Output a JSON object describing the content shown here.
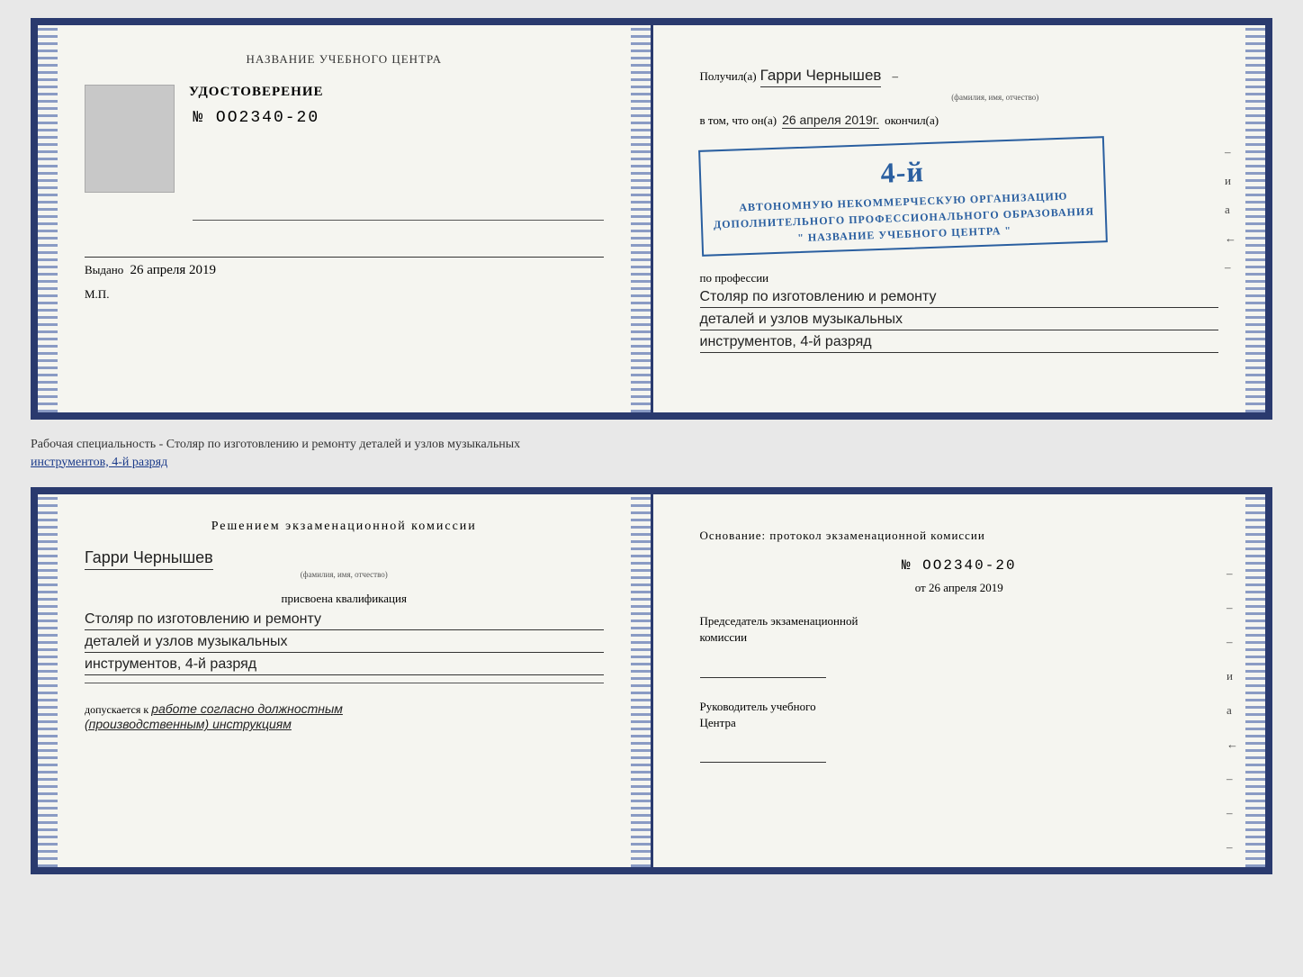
{
  "top": {
    "left": {
      "title": "НАЗВАНИЕ УЧЕБНОГО ЦЕНТРА",
      "udostoverenie": "УДОСТОВЕРЕНИЕ",
      "number": "№ OO2340-20",
      "vydano_label": "Выдано",
      "vydano_date": "26 апреля 2019",
      "mp": "М.П."
    },
    "right": {
      "poluchil": "Получил(а)",
      "name_handwritten": "Гарри Чернышев",
      "fio_subtitle": "(фамилия, имя, отчество)",
      "dash1": "–",
      "vtom": "в том, что он(а)",
      "date_handwritten": "26 апреля 2019г.",
      "okonchil": "окончил(а)",
      "stamp_line1": "АВТОНОМНУЮ НЕКОММЕРЧЕСКУЮ ОРГАНИЗАЦИЮ",
      "stamp_line2": "ДОПОЛНИТЕЛЬНОГО ПРОФЕССИОНАЛЬНОГО ОБРАЗОВАНИЯ",
      "stamp_line3": "\" НАЗВАНИЕ УЧЕБНОГО ЦЕНТРА \"",
      "stamp_4y": "4-й",
      "po_professii": "по профессии",
      "profession1": "Столяр по изготовлению и ремонту",
      "profession2": "деталей и узлов музыкальных",
      "profession3": "инструментов, 4-й разряд",
      "dash_i": "и",
      "dash_a": "а",
      "dash_left": "←",
      "dashes": [
        "–",
        "–",
        "–",
        "–",
        "–"
      ]
    }
  },
  "separator": {
    "text": "Рабочая специальность - Столяр по изготовлению и ремонту деталей и узлов музыкальных",
    "text2_underline": "инструментов, 4-й разряд"
  },
  "bottom": {
    "left": {
      "resheniem": "Решением  экзаменационной  комиссии",
      "name_handwritten": "Гарри Чернышев",
      "fio_subtitle": "(фамилия, имя, отчество)",
      "prisvoena": "присвоена квалификация",
      "profession1": "Столяр по изготовлению и ремонту",
      "profession2": "деталей и узлов музыкальных",
      "profession3": "инструментов, 4-й разряд",
      "dopuskaetsya": "допускается к",
      "dopusk_italic": "работе согласно должностным",
      "dopusk_italic2": "(производственным) инструкциям"
    },
    "right": {
      "osnovanie": "Основание: протокол  экзаменационной  комиссии",
      "number": "№  OO2340-20",
      "ot": "от",
      "date": "26 апреля 2019",
      "predsedatel_title": "Председатель экзаменационной",
      "predsedatel_title2": "комиссии",
      "rukovoditel_title": "Руководитель учебного",
      "rukovoditel_title2": "Центра",
      "dash_i": "и",
      "dash_a": "а",
      "dash_left": "←",
      "dashes": [
        "–",
        "–",
        "–",
        "–",
        "–",
        "–"
      ]
    }
  }
}
